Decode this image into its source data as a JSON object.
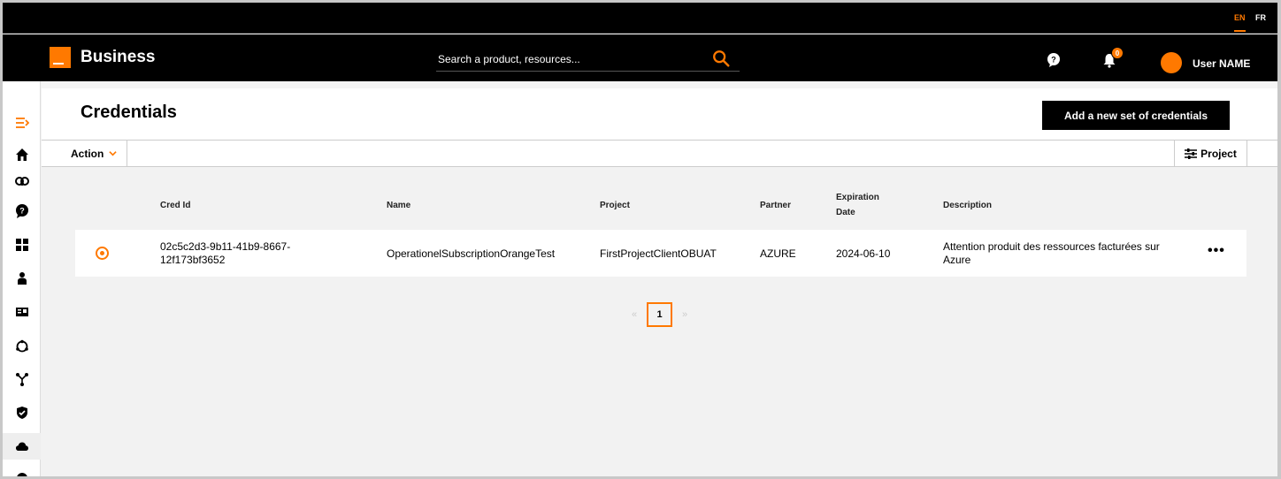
{
  "lang": {
    "en": "EN",
    "fr": "FR"
  },
  "header": {
    "brand": "Business",
    "search_placeholder": "Search a product, resources...",
    "notification_count": "0",
    "user_name": "User NAME"
  },
  "page": {
    "title": "Credentials",
    "add_button": "Add a new set of credentials",
    "action_label": "Action",
    "project_label": "Project"
  },
  "table": {
    "columns": [
      "Cred Id",
      "Name",
      "Project",
      "Partner",
      "Expiration Date",
      "Description"
    ],
    "rows": [
      {
        "cred_id": "02c5c2d3-9b11-41b9-8667-12f173bf3652",
        "name": "OperationelSubscriptionOrangeTest",
        "project": "FirstProjectClientOBUAT",
        "partner": "AZURE",
        "expiration": "2024-06-10",
        "description": "Attention produit des ressources facturées sur Azure",
        "menu": "•••"
      }
    ]
  },
  "pagination": {
    "prev": "«",
    "current": "1",
    "next": "»"
  },
  "colors": {
    "accent": "#ff7900",
    "header_bg": "#000000"
  }
}
